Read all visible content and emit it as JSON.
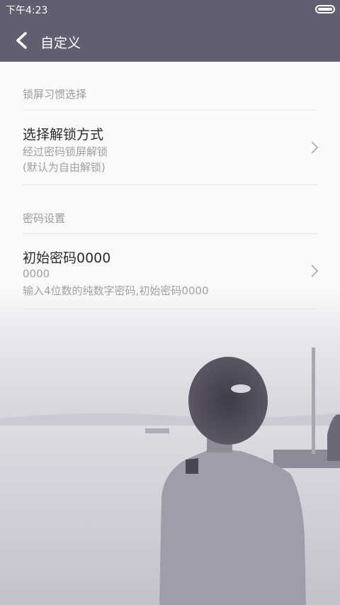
{
  "status_bar": {
    "time": "下午4:23",
    "icons": [
      "battery-icon"
    ]
  },
  "header": {
    "title": "自定义",
    "back_icon": "back-arrow-icon"
  },
  "sections": [
    {
      "header": "锁屏习惯选择",
      "item": {
        "title": "选择解锁方式",
        "subtitle_1": "经过密码锁屏解锁",
        "subtitle_2": "(默认为自由解锁)",
        "icon": "chevron-right-icon"
      }
    },
    {
      "header": "密码设置",
      "item": {
        "title": "初始密码0000",
        "subtitle_1": "0000",
        "subtitle_2": "输入4位数的纯数字密码,初始密码0000",
        "icon": "chevron-right-icon"
      }
    }
  ],
  "colors": {
    "header_bg": "#625d70",
    "panel_bg": "#fafafb",
    "title_text": "#2b2b2b",
    "sub_text": "#a0a0a0"
  }
}
